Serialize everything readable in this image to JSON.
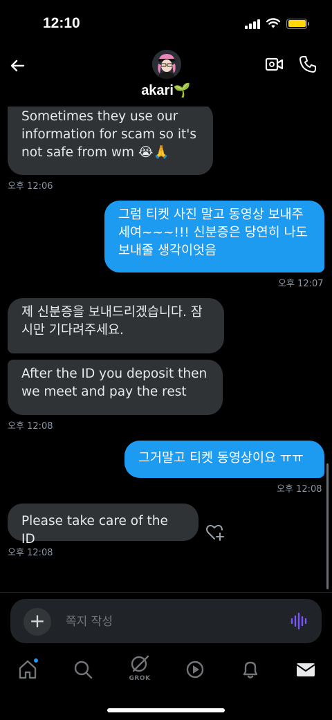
{
  "status_bar": {
    "time": "12:10"
  },
  "header": {
    "contact_name": "akari",
    "name_emoji": "🌱"
  },
  "messages": [
    {
      "direction": "in",
      "text": "Sometimes they use our information for scam so it's not safe from wm 😭🙏",
      "time": "오후 12:06"
    },
    {
      "direction": "out",
      "text": "그럼 티켓 사진 말고 동영상 보내주세여~~~!!! 신분증은 당연히 나도 보내줄 생각이엇음",
      "time": "오후 12:07"
    },
    {
      "direction": "in",
      "text": "제 신분증을 보내드리겠습니다. 잠시만 기다려주세요.",
      "time": ""
    },
    {
      "direction": "in",
      "text": "After the ID you deposit then we meet and pay the rest",
      "time": "오후 12:08"
    },
    {
      "direction": "out",
      "text": "그거말고 티켓 동영상이요 ㅠㅠ",
      "time": "오후 12:08"
    },
    {
      "direction": "in",
      "text": "Please take care of the ID",
      "time": "오후 12:08"
    }
  ],
  "composer": {
    "placeholder": "쪽지 작성",
    "add_label": "+"
  },
  "nav": {
    "items": [
      "home-icon",
      "search-icon",
      "grok-icon",
      "play-icon",
      "bell-icon",
      "mail-icon"
    ],
    "grok_label": "GROK"
  },
  "colors": {
    "outgoing": "#1d9bf0",
    "incoming": "#2f3336",
    "voice": "#7856ff",
    "battery": "#ffd60a"
  }
}
